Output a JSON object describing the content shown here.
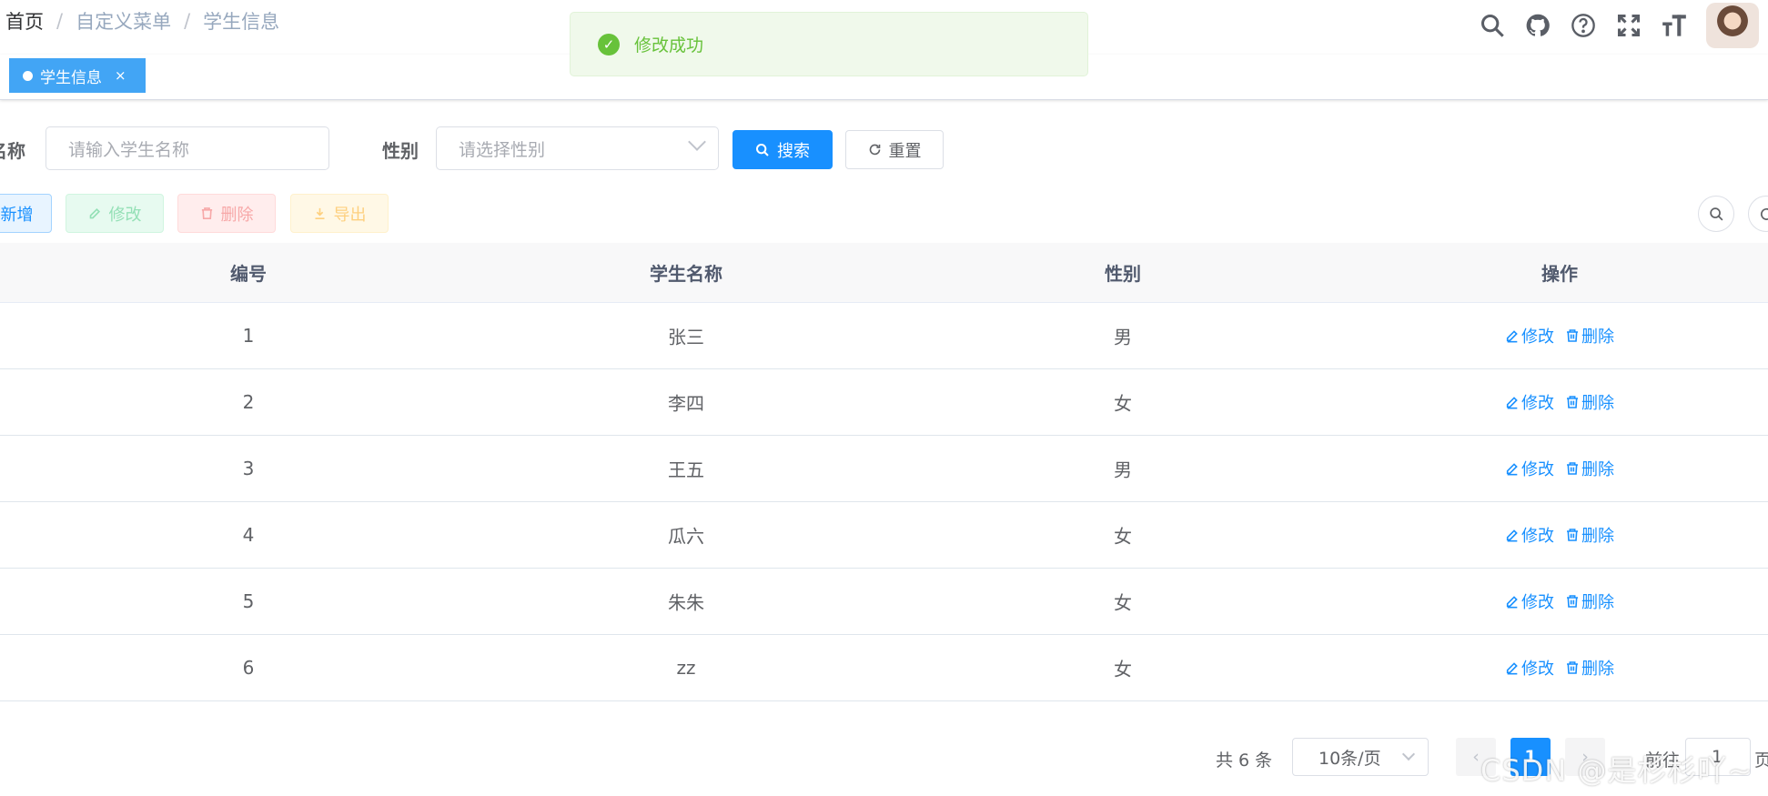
{
  "breadcrumb": [
    "首页",
    "自定义菜单",
    "学生信息"
  ],
  "breadcrumb_sep": "/",
  "nav_icons": [
    "search-icon",
    "github-icon",
    "question-icon",
    "fullscreen-icon",
    "font-size-icon"
  ],
  "tag": {
    "label": "学生信息",
    "close": "×"
  },
  "message": {
    "text": "修改成功",
    "type": "success"
  },
  "search": {
    "name_label": "名称",
    "name_placeholder": "请输入学生名称",
    "gender_label": "性别",
    "gender_placeholder": "请选择性别",
    "search_btn": "搜索",
    "reset_btn": "重置"
  },
  "toolbar": {
    "add": "新增",
    "edit": "修改",
    "delete": "删除",
    "export": "导出"
  },
  "table": {
    "columns": [
      "编号",
      "学生名称",
      "性别",
      "操作"
    ],
    "rows": [
      {
        "id": "1",
        "name": "张三",
        "gender": "男"
      },
      {
        "id": "2",
        "name": "李四",
        "gender": "女"
      },
      {
        "id": "3",
        "name": "王五",
        "gender": "男"
      },
      {
        "id": "4",
        "name": "瓜六",
        "gender": "女"
      },
      {
        "id": "5",
        "name": "朱朱",
        "gender": "女"
      },
      {
        "id": "6",
        "name": "zz",
        "gender": "女"
      }
    ],
    "op_edit": "修改",
    "op_delete": "删除"
  },
  "pagination": {
    "total": "共 6 条",
    "page_size": "10条/页",
    "prev": "‹",
    "current": "1",
    "next": "›",
    "goto": "前往",
    "goto_value": "1",
    "page_unit": "页"
  },
  "watermark": "CSDN @是杉杉吖~",
  "colors": {
    "primary": "#1890ff",
    "success": "#67c23a",
    "danger": "#ff4949",
    "warning": "#ffba00"
  }
}
